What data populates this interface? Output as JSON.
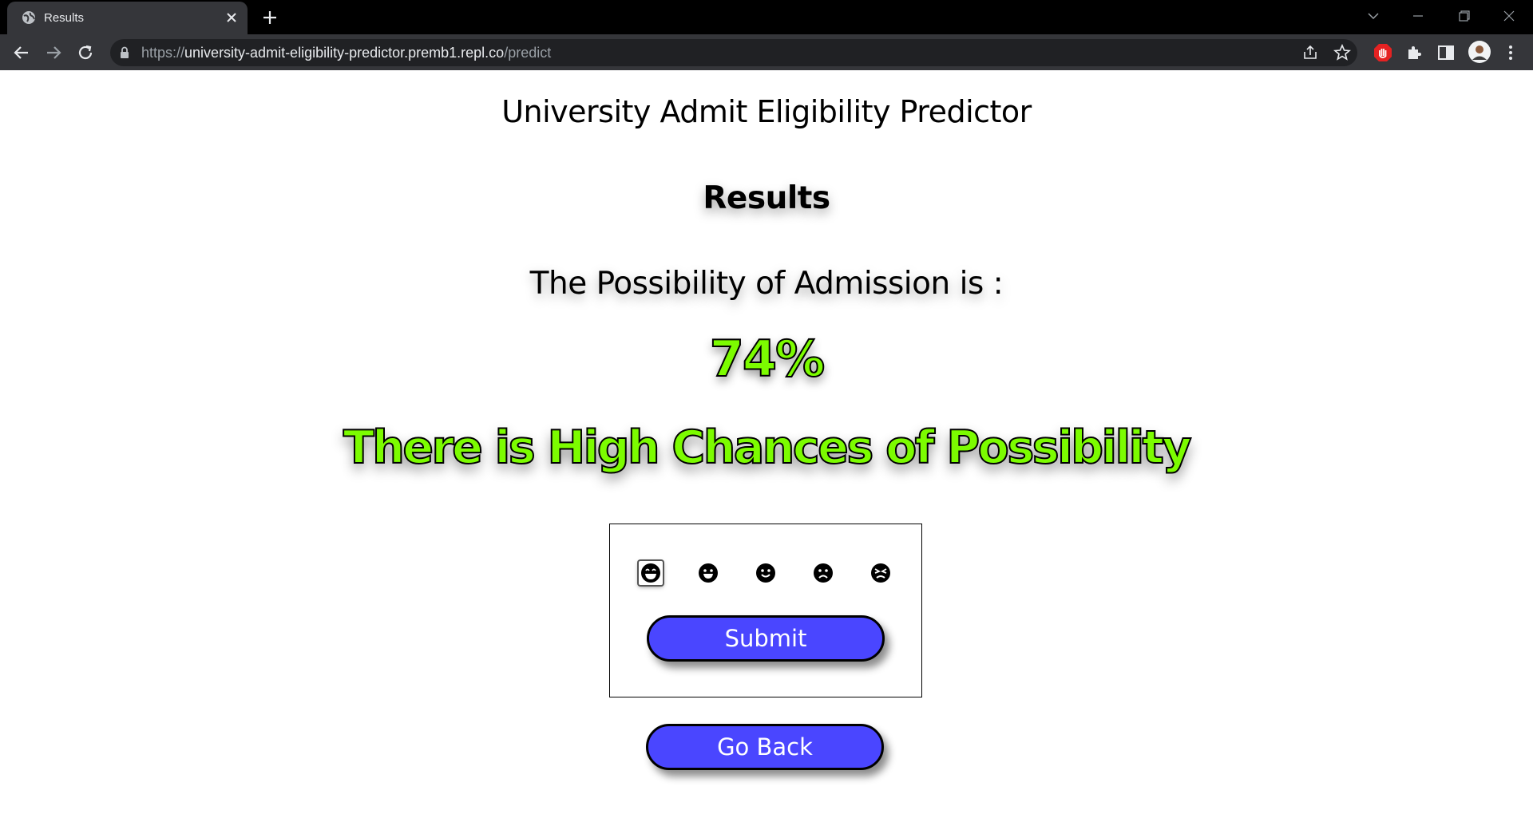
{
  "browser": {
    "tab_title": "Results",
    "url_scheme": "https://",
    "url_host": "university-admit-eligibility-predictor.premb1.repl.co",
    "url_path": "/predict"
  },
  "page": {
    "heading": "University Admit Eligibility Predictor",
    "results_label": "Results",
    "possibility_label": "The Possibility of Admission is :",
    "percentage": "74%",
    "verdict": "There is High Chances of Possibility",
    "verdict_color": "#7cfc00"
  },
  "feedback": {
    "options": [
      "very-happy-icon",
      "happy-icon",
      "smile-icon",
      "sad-icon",
      "angry-icon"
    ],
    "selected_index": 0,
    "submit_label": "Submit"
  },
  "go_back_label": "Go Back",
  "colors": {
    "button_bg": "#4a46ff",
    "accent_green": "#7cfc00"
  }
}
